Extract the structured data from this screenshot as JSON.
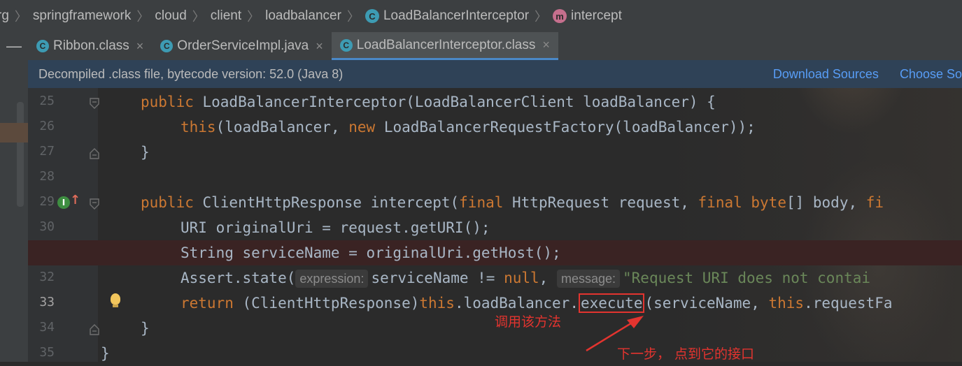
{
  "breadcrumb": {
    "items": [
      "rg",
      "springframework",
      "cloud",
      "client",
      "loadbalancer",
      "LoadBalancerInterceptor",
      "intercept"
    ],
    "class_icon": "C",
    "method_icon": "m"
  },
  "tabs": [
    {
      "label": "Ribbon.class",
      "icon": "class-icon",
      "active": false
    },
    {
      "label": "OrderServiceImpl.java",
      "icon": "class-icon",
      "active": false
    },
    {
      "label": "LoadBalancerInterceptor.class",
      "icon": "class-icon",
      "active": true
    }
  ],
  "tab_close": "×",
  "infobar": {
    "message": "Decompiled .class file, bytecode version: 52.0 (Java 8)",
    "download_sources": "Download Sources",
    "choose_sources": "Choose So"
  },
  "lines": [
    "25",
    "26",
    "27",
    "28",
    "29",
    "30",
    "31",
    "32",
    "33",
    "34",
    "35"
  ],
  "code": {
    "l25": {
      "kw": "public",
      "rest": " LoadBalancerInterceptor(LoadBalancerClient loadBalancer) {"
    },
    "l26": {
      "kw": "this",
      "a": "(loadBalancer, ",
      "kw2": "new",
      "b": " LoadBalancerRequestFactory(loadBalancer));"
    },
    "l27": "}",
    "l29": {
      "kw": "public",
      "a": " ClientHttpResponse intercept(",
      "kw2": "final",
      "b": " HttpRequest request, ",
      "kw3": "final byte",
      "c": "[] body, ",
      "kw4": "fi"
    },
    "l30": "URI originalUri = request.getURI();",
    "l31": "String serviceName = originalUri.getHost();",
    "l32": {
      "a": "Assert.state(",
      "hint1": "expression:",
      "b": "serviceName != ",
      "kw": "null",
      "c": ", ",
      "hint2": "message:",
      "str": "\"Request URI does not contai"
    },
    "l33": {
      "kw": "return",
      "a": " (ClientHttpResponse)",
      "kw2": "this",
      "b": ".loadBalancer.",
      "method": "execute",
      "c": "(serviceName, ",
      "kw3": "this",
      "d": ".requestFa"
    },
    "l34": "}",
    "l35": "}"
  },
  "annotations": {
    "call_method": "调用该方法",
    "next_step": "下一步， 点到它的接口"
  },
  "colors": {
    "keyword": "#cc7832",
    "string": "#6a8759",
    "annotation": "#e3342f",
    "link": "#589df6"
  }
}
